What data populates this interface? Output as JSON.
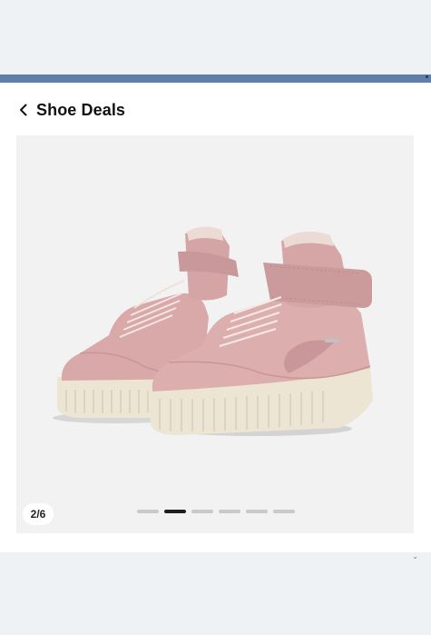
{
  "header": {
    "title": "Shoe Deals",
    "back_icon": "chevron-left-icon"
  },
  "gallery": {
    "counter": "2/6",
    "current_index": 2,
    "total": 6,
    "image": "pink high-top sneakers with fur lining",
    "colors": {
      "shoe": "#d9a9aa",
      "sole": "#ede5d4",
      "background": "#f2f2f2"
    }
  },
  "colors": {
    "accent_strip": "#5f7fa8",
    "page_bg": "#eff2f5"
  }
}
